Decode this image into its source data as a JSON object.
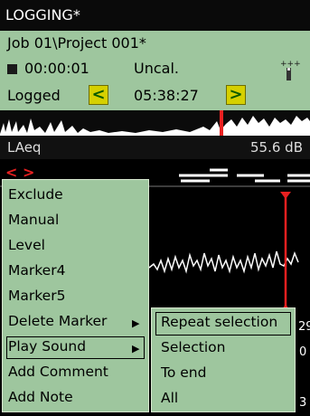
{
  "title": "LOGGING*",
  "info": {
    "path": "Job 01\\Project 001*",
    "timer": "00:00:01",
    "cal": "Uncal.",
    "logged_label": "Logged",
    "logged_time": "05:38:27",
    "prev_glyph": "<",
    "next_glyph": ">"
  },
  "level": {
    "label": "LAeq",
    "value": "55.6 dB"
  },
  "chart_nav": "< >",
  "menu": {
    "items": [
      "Exclude",
      "Manual",
      "Level",
      "Marker4",
      "Marker5",
      "Delete Marker",
      "Play Sound",
      "Add Comment",
      "Add Note"
    ],
    "selected": "Play Sound",
    "submenu_arrow": "▶"
  },
  "submenu": {
    "items": [
      "Repeat selection",
      "Selection",
      "To end",
      "All"
    ],
    "selected": "Repeat selection"
  },
  "side_numbers": [
    "29",
    "0",
    "3"
  ],
  "colors": {
    "panel": "#9ec69e",
    "marker": "#e82020",
    "button": "#d6d000",
    "background": "#000000"
  }
}
